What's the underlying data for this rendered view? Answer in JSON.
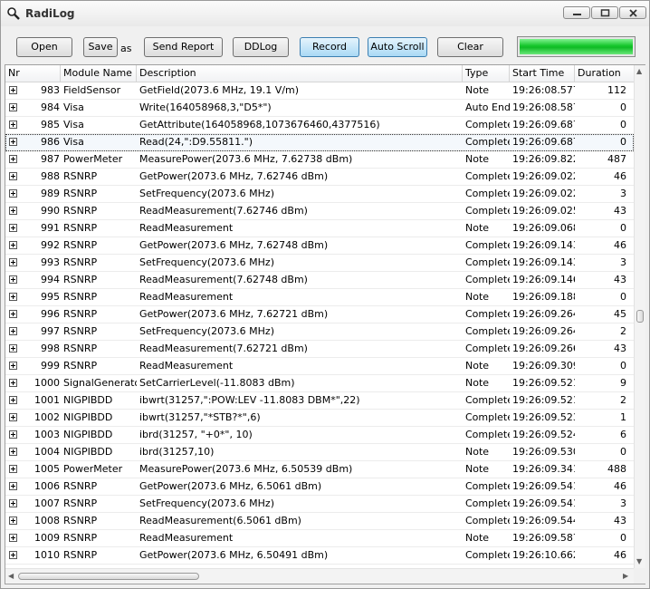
{
  "window": {
    "title": "RadiLog",
    "icon": "magnifier-icon"
  },
  "toolbar": {
    "open_label": "Open",
    "save_label": "Save",
    "as_label": "as",
    "send_report_label": "Send Report",
    "ddlog_label": "DDLog",
    "record_label": "Record",
    "autoscroll_label": "Auto Scroll",
    "clear_label": "Clear",
    "progress_fraction": 1.0,
    "progress_color": "#14c62a"
  },
  "table": {
    "columns": [
      "Nr",
      "Module Name",
      "Description",
      "Type",
      "Start Time",
      "Duration"
    ],
    "rows": [
      {
        "nr": "983",
        "module": "FieldSensor",
        "desc": "GetField(2073.6 MHz, 19.1 V/m)",
        "type": "Note",
        "time": "19:26:08.577",
        "dur": "112"
      },
      {
        "nr": "984",
        "module": "Visa",
        "desc": "Write(164058968,3,\"D5*\")",
        "type": "Auto End",
        "time": "19:26:08.587",
        "dur": "0"
      },
      {
        "nr": "985",
        "module": "Visa",
        "desc": "GetAttribute(164058968,1073676460,4377516)",
        "type": "Complete",
        "time": "19:26:09.687",
        "dur": "0"
      },
      {
        "nr": "986",
        "module": "Visa",
        "desc": "Read(24,\":D9.55811.\")",
        "type": "Complete",
        "time": "19:26:09.687",
        "dur": "0",
        "selected": true
      },
      {
        "nr": "987",
        "module": "PowerMeter",
        "desc": "MeasurePower(2073.6 MHz, 7.62738 dBm)",
        "type": "Note",
        "time": "19:26:09.822",
        "dur": "487"
      },
      {
        "nr": "988",
        "module": "RSNRP",
        "desc": "GetPower(2073.6 MHz, 7.62746 dBm)",
        "type": "Complete",
        "time": "19:26:09.022",
        "dur": "46"
      },
      {
        "nr": "989",
        "module": "RSNRP",
        "desc": "SetFrequency(2073.6 MHz)",
        "type": "Complete",
        "time": "19:26:09.022",
        "dur": "3"
      },
      {
        "nr": "990",
        "module": "RSNRP",
        "desc": "ReadMeasurement(7.62746 dBm)",
        "type": "Complete",
        "time": "19:26:09.025",
        "dur": "43"
      },
      {
        "nr": "991",
        "module": "RSNRP",
        "desc": "ReadMeasurement",
        "type": "Note",
        "time": "19:26:09.068",
        "dur": "0"
      },
      {
        "nr": "992",
        "module": "RSNRP",
        "desc": "GetPower(2073.6 MHz, 7.62748 dBm)",
        "type": "Complete",
        "time": "19:26:09.143",
        "dur": "46"
      },
      {
        "nr": "993",
        "module": "RSNRP",
        "desc": "SetFrequency(2073.6 MHz)",
        "type": "Complete",
        "time": "19:26:09.143",
        "dur": "3"
      },
      {
        "nr": "994",
        "module": "RSNRP",
        "desc": "ReadMeasurement(7.62748 dBm)",
        "type": "Complete",
        "time": "19:26:09.146",
        "dur": "43"
      },
      {
        "nr": "995",
        "module": "RSNRP",
        "desc": "ReadMeasurement",
        "type": "Note",
        "time": "19:26:09.188",
        "dur": "0"
      },
      {
        "nr": "996",
        "module": "RSNRP",
        "desc": "GetPower(2073.6 MHz, 7.62721 dBm)",
        "type": "Complete",
        "time": "19:26:09.264",
        "dur": "45"
      },
      {
        "nr": "997",
        "module": "RSNRP",
        "desc": "SetFrequency(2073.6 MHz)",
        "type": "Complete",
        "time": "19:26:09.264",
        "dur": "2"
      },
      {
        "nr": "998",
        "module": "RSNRP",
        "desc": "ReadMeasurement(7.62721 dBm)",
        "type": "Complete",
        "time": "19:26:09.266",
        "dur": "43"
      },
      {
        "nr": "999",
        "module": "RSNRP",
        "desc": "ReadMeasurement",
        "type": "Note",
        "time": "19:26:09.309",
        "dur": "0"
      },
      {
        "nr": "1000",
        "module": "SignalGenerator",
        "desc": "SetCarrierLevel(-11.8083 dBm)",
        "type": "Note",
        "time": "19:26:09.521",
        "dur": "9"
      },
      {
        "nr": "1001",
        "module": "NIGPIBDD",
        "desc": "ibwrt(31257,\":POW:LEV -11.8083 DBM*\",22)",
        "type": "Complete",
        "time": "19:26:09.521",
        "dur": "2"
      },
      {
        "nr": "1002",
        "module": "NIGPIBDD",
        "desc": "ibwrt(31257,\"*STB?*\",6)",
        "type": "Complete",
        "time": "19:26:09.523",
        "dur": "1"
      },
      {
        "nr": "1003",
        "module": "NIGPIBDD",
        "desc": "ibrd(31257, \"+0*\", 10)",
        "type": "Complete",
        "time": "19:26:09.524",
        "dur": "6"
      },
      {
        "nr": "1004",
        "module": "NIGPIBDD",
        "desc": "ibrd(31257,10)",
        "type": "Note",
        "time": "19:26:09.530",
        "dur": "0"
      },
      {
        "nr": "1005",
        "module": "PowerMeter",
        "desc": "MeasurePower(2073.6 MHz, 6.50539 dBm)",
        "type": "Note",
        "time": "19:26:09.341",
        "dur": "488"
      },
      {
        "nr": "1006",
        "module": "RSNRP",
        "desc": "GetPower(2073.6 MHz, 6.5061 dBm)",
        "type": "Complete",
        "time": "19:26:09.541",
        "dur": "46"
      },
      {
        "nr": "1007",
        "module": "RSNRP",
        "desc": "SetFrequency(2073.6 MHz)",
        "type": "Complete",
        "time": "19:26:09.541",
        "dur": "3"
      },
      {
        "nr": "1008",
        "module": "RSNRP",
        "desc": "ReadMeasurement(6.5061 dBm)",
        "type": "Complete",
        "time": "19:26:09.544",
        "dur": "43"
      },
      {
        "nr": "1009",
        "module": "RSNRP",
        "desc": "ReadMeasurement",
        "type": "Note",
        "time": "19:26:09.587",
        "dur": "0"
      },
      {
        "nr": "1010",
        "module": "RSNRP",
        "desc": "GetPower(2073.6 MHz, 6.50491 dBm)",
        "type": "Complete",
        "time": "19:26:10.662",
        "dur": "46"
      }
    ]
  }
}
